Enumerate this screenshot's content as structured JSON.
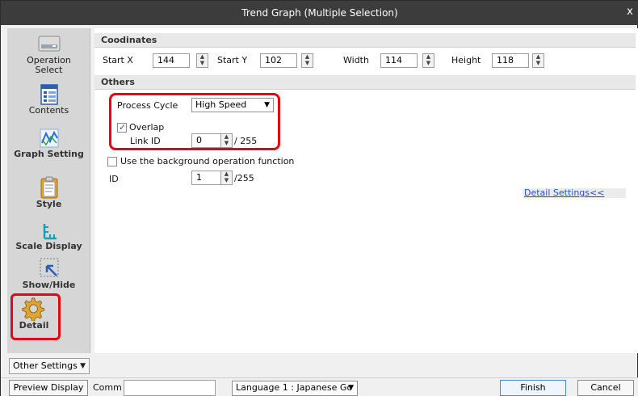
{
  "window": {
    "title": "Trend Graph (Multiple Selection)",
    "close_glyph": "x"
  },
  "sidebar": {
    "items": [
      {
        "label": "Operation Select",
        "icon": "operation-select-icon"
      },
      {
        "label": "Contents",
        "icon": "contents-icon"
      },
      {
        "label": "Graph Setting",
        "icon": "graph-setting-icon"
      },
      {
        "label": "Style",
        "icon": "style-icon"
      },
      {
        "label": "Scale Display",
        "icon": "scale-display-icon"
      },
      {
        "label": "Show/Hide",
        "icon": "show-hide-icon"
      },
      {
        "label": "Detail",
        "icon": "gear-icon"
      }
    ],
    "other_settings": "Other Settings"
  },
  "coordinates": {
    "heading": "Coodinates",
    "start_x_label": "Start X",
    "start_x": "144",
    "start_y_label": "Start Y",
    "start_y": "102",
    "width_label": "Width",
    "width": "114",
    "height_label": "Height",
    "height": "118"
  },
  "others": {
    "heading": "Others",
    "process_cycle_label": "Process Cycle",
    "process_cycle": "High Speed",
    "overlap_label": "Overlap",
    "overlap_checked": true,
    "link_id_label": "Link ID",
    "link_id": "0",
    "link_id_max": "/ 255",
    "background_op_label": "Use the background operation function",
    "background_op_checked": false,
    "id_label": "ID",
    "id": "1",
    "id_max": "/255",
    "detail_settings": "Detail Settings<<"
  },
  "bottom": {
    "preview_display": "Preview Display",
    "comm_label": "Comm",
    "comm_value": "",
    "language": "Language 1 : Japanese Go",
    "finish": "Finish",
    "cancel": "Cancel"
  },
  "colors": {
    "highlight": "#e30613",
    "titlebar": "#3c3c3c",
    "link": "#2a4fd6"
  }
}
